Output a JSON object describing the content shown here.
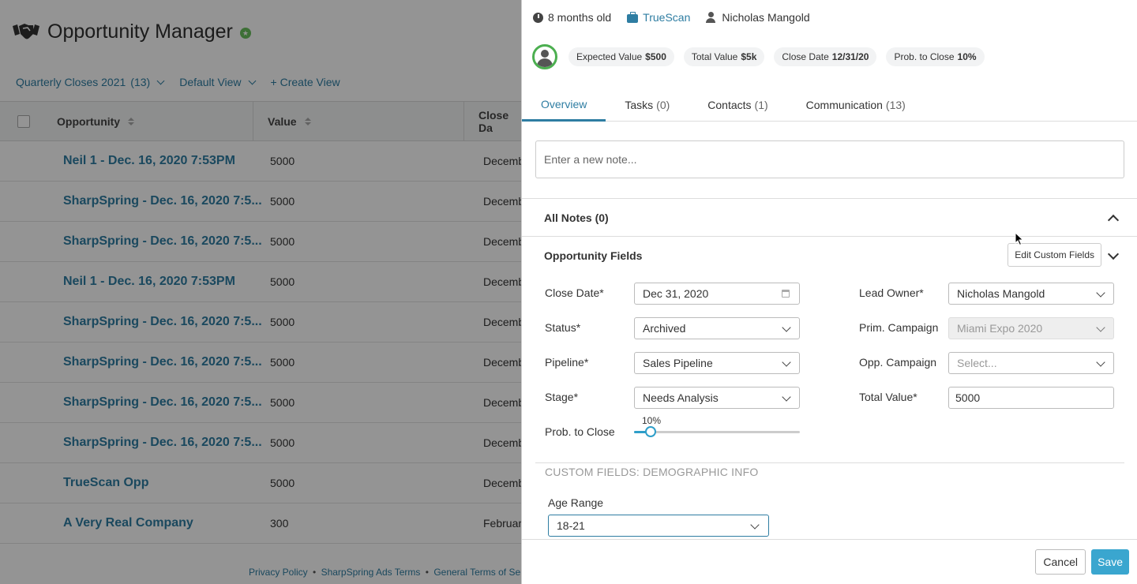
{
  "app": {
    "title": "Opportunity Manager",
    "view_bar": {
      "list_name": "Quarterly Closes 2021",
      "list_count": "(13)",
      "view_label": "Default View",
      "create_view": "+ Create View"
    },
    "columns": [
      "Opportunity",
      "Value",
      "Close Da"
    ],
    "rows": [
      {
        "name": "Neil 1 - Dec. 16, 2020 7:53PM",
        "value": "5000",
        "date": "Decemb"
      },
      {
        "name": "SharpSpring - Dec. 16, 2020 7:5...",
        "value": "5000",
        "date": "Decemb"
      },
      {
        "name": "SharpSpring - Dec. 16, 2020 7:5...",
        "value": "5000",
        "date": "Decemb"
      },
      {
        "name": "Neil 1 - Dec. 16, 2020 7:53PM",
        "value": "5000",
        "date": "Decemb"
      },
      {
        "name": "SharpSpring - Dec. 16, 2020 7:5...",
        "value": "5000",
        "date": "Decemb"
      },
      {
        "name": "SharpSpring - Dec. 16, 2020 7:5...",
        "value": "5000",
        "date": "Decemb"
      },
      {
        "name": "SharpSpring - Dec. 16, 2020 7:5...",
        "value": "5000",
        "date": "Decemb"
      },
      {
        "name": "SharpSpring - Dec. 16, 2020 7:5...",
        "value": "5000",
        "date": "Decemb"
      },
      {
        "name": "TrueScan Opp",
        "value": "5000",
        "date": "Decemb"
      },
      {
        "name": "A Very Real Company",
        "value": "300",
        "date": "Februar"
      }
    ],
    "footer": {
      "privacy": "Privacy Policy",
      "sep": "•",
      "ads_terms": "SharpSpring Ads Terms",
      "general_terms": "General Terms of Service"
    }
  },
  "panel": {
    "age": "8 months old",
    "company": "TrueScan",
    "owner": "Nicholas Mangold",
    "chips": [
      {
        "label": "Expected Value",
        "value": "$500"
      },
      {
        "label": "Total Value",
        "value": "$5k"
      },
      {
        "label": "Close Date",
        "value": "12/31/20"
      },
      {
        "label": "Prob. to Close",
        "value": "10%"
      }
    ],
    "tabs": [
      {
        "label": "Overview",
        "count": ""
      },
      {
        "label": "Tasks",
        "count": "(0)"
      },
      {
        "label": "Contacts",
        "count": "(1)"
      },
      {
        "label": "Communication",
        "count": "(13)"
      }
    ],
    "note_placeholder": "Enter a new note...",
    "all_notes": "All Notes (0)",
    "opp_fields": "Opportunity Fields",
    "edit_custom_fields": "Edit Custom Fields",
    "fields": {
      "close_date": {
        "label": "Close Date*",
        "value": "Dec 31, 2020"
      },
      "status": {
        "label": "Status*",
        "value": "Archived"
      },
      "pipeline": {
        "label": "Pipeline*",
        "value": "Sales Pipeline"
      },
      "stage": {
        "label": "Stage*",
        "value": "Needs Analysis"
      },
      "prob": {
        "label": "Prob. to Close",
        "value": "10%",
        "fraction": 0.1
      },
      "lead_owner": {
        "label": "Lead Owner*",
        "value": "Nicholas Mangold"
      },
      "prim_campaign": {
        "label": "Prim. Campaign",
        "value": "Miami Expo 2020"
      },
      "opp_campaign": {
        "label": "Opp. Campaign",
        "value": "Select..."
      },
      "total_value": {
        "label": "Total Value*",
        "value": "5000"
      }
    },
    "custom_header": "CUSTOM FIELDS: DEMOGRAPHIC INFO",
    "age_range": {
      "label": "Age Range",
      "value": "18-21"
    },
    "cancel": "Cancel",
    "save": "Save"
  },
  "colors": {
    "accent": "#2e7da2",
    "save_button": "#3aa6cf",
    "avatar_ring": "#4caf50",
    "star_badge": "#6abf5e"
  },
  "icons": [
    "handshake-icon",
    "star-badge-icon",
    "clock-icon",
    "briefcase-icon",
    "user-icon",
    "calendar-icon",
    "chevron-down-icon",
    "chevron-up-icon",
    "sort-icon"
  ]
}
